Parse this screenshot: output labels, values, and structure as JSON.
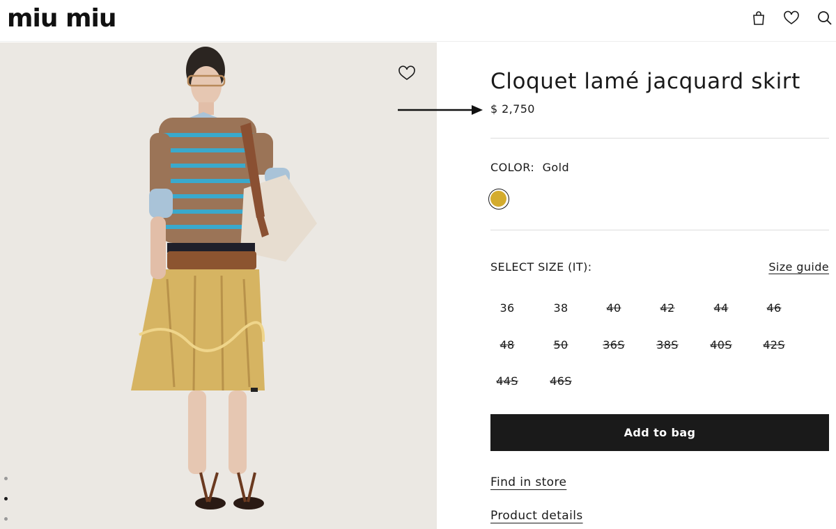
{
  "brand": {
    "logo_text": "miu miu"
  },
  "header": {
    "icons": [
      "bag-icon",
      "heart-icon",
      "search-icon"
    ]
  },
  "product": {
    "title": "Cloquet lamé jacquard skirt",
    "price": "$ 2,750",
    "color_label": "COLOR:",
    "color_value": "Gold",
    "swatch_color": "#d4ac2e",
    "select_size_label": "SELECT SIZE (IT):",
    "size_guide_label": "Size guide",
    "sizes": [
      {
        "label": "36",
        "available": true
      },
      {
        "label": "38",
        "available": true
      },
      {
        "label": "40",
        "available": false
      },
      {
        "label": "42",
        "available": false
      },
      {
        "label": "44",
        "available": false
      },
      {
        "label": "46",
        "available": false
      },
      {
        "label": "48",
        "available": false
      },
      {
        "label": "50",
        "available": false
      },
      {
        "label": "36S",
        "available": false
      },
      {
        "label": "38S",
        "available": false
      },
      {
        "label": "40S",
        "available": false
      },
      {
        "label": "42S",
        "available": false
      },
      {
        "label": "44S",
        "available": false
      },
      {
        "label": "46S",
        "available": false
      }
    ],
    "add_to_bag_label": "Add to bag",
    "find_in_store_label": "Find in store",
    "product_details_label": "Product details"
  },
  "gallery": {
    "active_index": 1,
    "count": 3
  },
  "colors": {
    "button_bg": "#1a1a1a",
    "image_bg": "#ebe8e3",
    "gold": "#d4ac2e"
  }
}
